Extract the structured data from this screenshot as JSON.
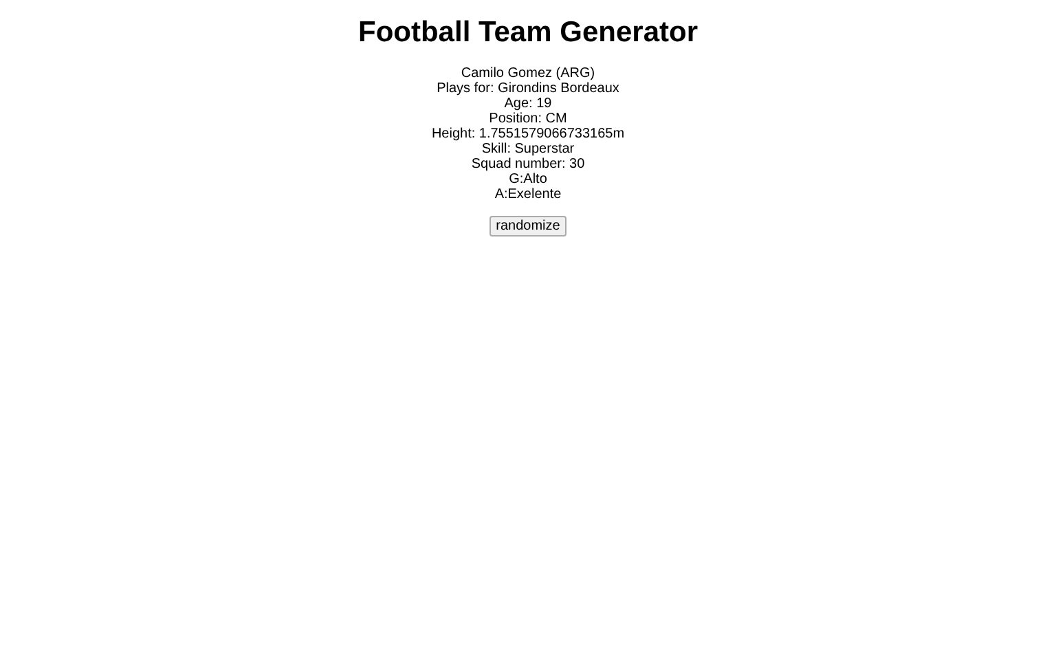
{
  "title": "Football Team Generator",
  "player_lines": [
    "Camilo Gomez (ARG)",
    "Plays for: Girondins Bordeaux",
    "Age: 19",
    "Position: CM",
    "Height: 1.7551579066733165m",
    "Skill: Superstar",
    "Squad number: 30",
    "G:Alto",
    "A:Exelente"
  ],
  "button": "randomize"
}
